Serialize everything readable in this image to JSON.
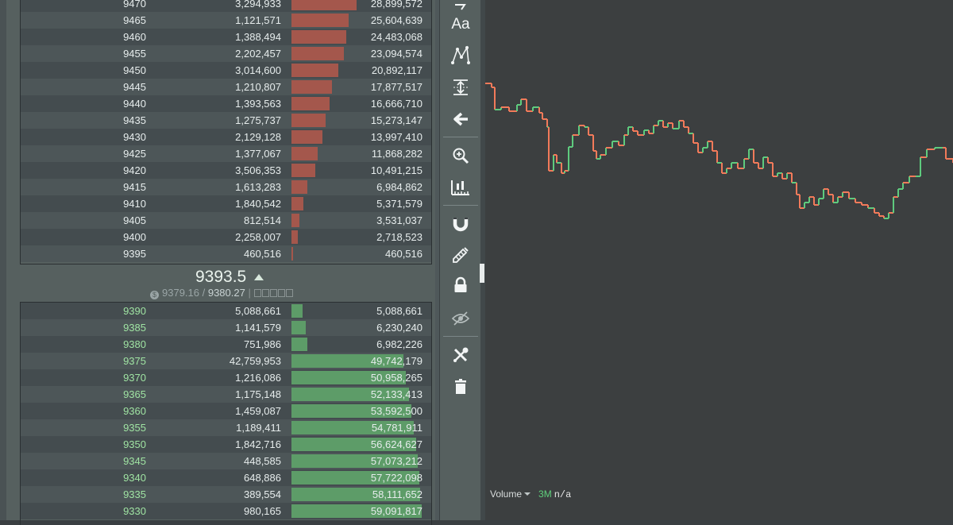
{
  "orderbook": {
    "asks": [
      {
        "price": "9470",
        "size": "3,294,933",
        "total": "28,899,572",
        "depth": 0.5
      },
      {
        "price": "9465",
        "size": "1,121,571",
        "total": "25,604,639",
        "depth": 0.44
      },
      {
        "price": "9460",
        "size": "1,388,494",
        "total": "24,483,068",
        "depth": 0.42
      },
      {
        "price": "9455",
        "size": "2,202,457",
        "total": "23,094,574",
        "depth": 0.4
      },
      {
        "price": "9450",
        "size": "3,014,600",
        "total": "20,892,117",
        "depth": 0.36
      },
      {
        "price": "9445",
        "size": "1,210,807",
        "total": "17,877,517",
        "depth": 0.31
      },
      {
        "price": "9440",
        "size": "1,393,563",
        "total": "16,666,710",
        "depth": 0.29
      },
      {
        "price": "9435",
        "size": "1,275,737",
        "total": "15,273,147",
        "depth": 0.26
      },
      {
        "price": "9430",
        "size": "2,129,128",
        "total": "13,997,410",
        "depth": 0.24
      },
      {
        "price": "9425",
        "size": "1,377,067",
        "total": "11,868,282",
        "depth": 0.2
      },
      {
        "price": "9420",
        "size": "3,506,353",
        "total": "10,491,215",
        "depth": 0.18
      },
      {
        "price": "9415",
        "size": "1,613,283",
        "total": "6,984,862",
        "depth": 0.12
      },
      {
        "price": "9410",
        "size": "1,840,542",
        "total": "5,371,579",
        "depth": 0.09
      },
      {
        "price": "9405",
        "size": "812,514",
        "total": "3,531,037",
        "depth": 0.06
      },
      {
        "price": "9400",
        "size": "2,258,007",
        "total": "2,718,523",
        "depth": 0.047
      },
      {
        "price": "9395",
        "size": "460,516",
        "total": "460,516",
        "depth": 0.008
      }
    ],
    "bids": [
      {
        "price": "9390",
        "size": "5,088,661",
        "total": "5,088,661",
        "depth": 0.088
      },
      {
        "price": "9385",
        "size": "1,141,579",
        "total": "6,230,240",
        "depth": 0.11
      },
      {
        "price": "9380",
        "size": "751,986",
        "total": "6,982,226",
        "depth": 0.12
      },
      {
        "price": "9375",
        "size": "42,759,953",
        "total": "49,742,179",
        "depth": 0.86
      },
      {
        "price": "9370",
        "size": "1,216,086",
        "total": "50,958,265",
        "depth": 0.88
      },
      {
        "price": "9365",
        "size": "1,175,148",
        "total": "52,133,413",
        "depth": 0.9
      },
      {
        "price": "9360",
        "size": "1,459,087",
        "total": "53,592,500",
        "depth": 0.92
      },
      {
        "price": "9355",
        "size": "1,189,411",
        "total": "54,781,911",
        "depth": 0.94
      },
      {
        "price": "9350",
        "size": "1,842,716",
        "total": "56,624,627",
        "depth": 0.96
      },
      {
        "price": "9345",
        "size": "448,585",
        "total": "57,073,212",
        "depth": 0.97
      },
      {
        "price": "9340",
        "size": "648,886",
        "total": "57,722,098",
        "depth": 0.98
      },
      {
        "price": "9335",
        "size": "389,554",
        "total": "58,111,652",
        "depth": 0.99
      },
      {
        "price": "9330",
        "size": "980,165",
        "total": "59,091,817",
        "depth": 1.0
      }
    ],
    "last_price": "9393.5",
    "index_price": "9379.16",
    "mark_price": "9380.27",
    "separator": "|",
    "colors": {
      "ask_bar": "#a4574c",
      "bid_bar": "#5d9c68",
      "bid_price": "#9fe3a2"
    }
  },
  "toolbar": {
    "tools": [
      "text-tool-icon",
      "pattern-tool-icon",
      "measure-tool-icon",
      "back-arrow-icon",
      "zoom-in-icon",
      "ruler-icon",
      "magnet-icon",
      "stay-in-drawing-mode-icon",
      "lock-icon",
      "hide-icon",
      "tools-icon",
      "trash-icon"
    ],
    "text_tool_label": "Aa"
  },
  "chart": {
    "volume_label": "Volume",
    "volume_period": "3M",
    "volume_value": "n/a",
    "colors": {
      "up": "#5ecb7e",
      "down": "#f27a5a"
    }
  }
}
